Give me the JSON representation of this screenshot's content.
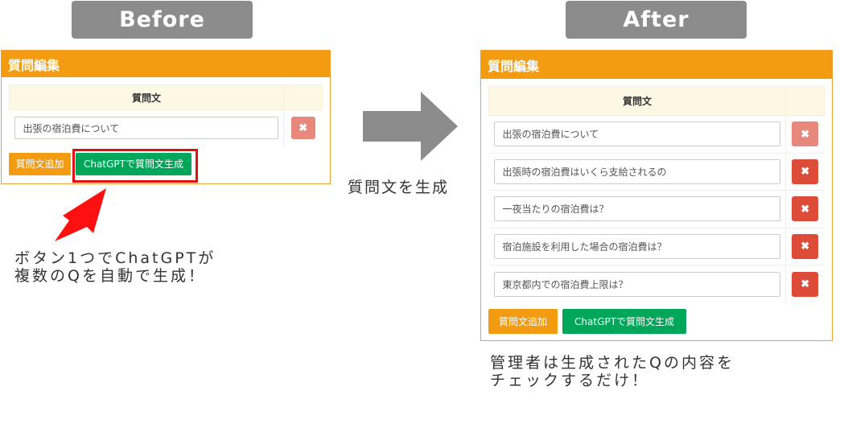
{
  "labels": {
    "before": "Before",
    "after": "After",
    "arrow_label": "質問文を生成"
  },
  "before_panel": {
    "title": "質問編集",
    "column_header": "質問文",
    "questions": [
      "出張の宿泊費について"
    ],
    "add_button": "質問文追加",
    "generate_button": "ChatGPTで質問文生成"
  },
  "after_panel": {
    "title": "質問編集",
    "column_header": "質問文",
    "questions": [
      "出張の宿泊費について",
      "出張時の宿泊費はいくら支給されるの",
      "一夜当たりの宿泊費は？",
      "宿泊施設を利用した場合の宿泊費は？",
      "東京都内での宿泊費上限は？"
    ],
    "add_button": "質問文追加",
    "generate_button": "ChatGPTで質問文生成"
  },
  "notes": {
    "left_line1": "ボタン1つでChatGPTが",
    "left_line2": "複数のQを自動で生成！",
    "right_line1": "管理者は生成されたQの内容を",
    "right_line2": "チェックするだけ！"
  },
  "icons": {
    "delete": "close-icon",
    "big_arrow": "arrow-right-icon",
    "pointer": "arrow-pointer-icon"
  },
  "colors": {
    "panel_header": "#f39c12",
    "table_header": "#fcf8e3",
    "delete_button": "#dd4b39",
    "generate_button": "#00a65a",
    "highlight": "#e01010",
    "label_pill": "#8c8c8c"
  }
}
